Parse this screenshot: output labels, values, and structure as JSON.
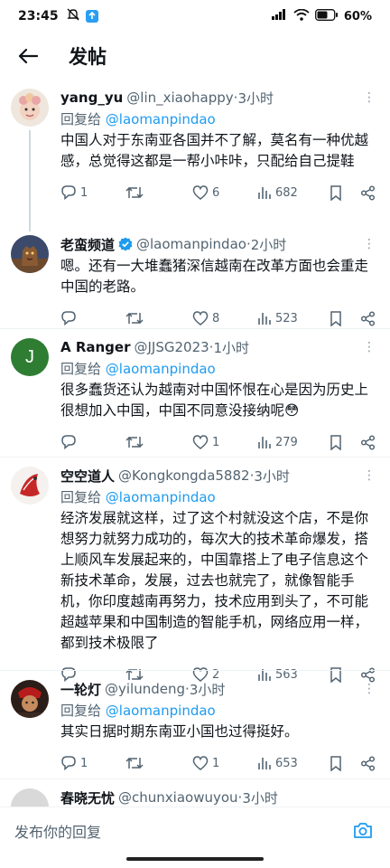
{
  "status_bar": {
    "time": "23:45",
    "battery": "60%"
  },
  "header": {
    "title": "发帖"
  },
  "tweets": [
    {
      "name": "yang_yu",
      "handle": "@lin_xiaohappy",
      "dot": "·",
      "time": "3小时",
      "reply_prefix": "回复给 ",
      "reply_mention": "@laomanpindao",
      "text": "中国人对于东南亚各国并不了解，莫名有一种优越感，总觉得这都是一帮小咔咔，只配给自己提鞋",
      "replies": "1",
      "retweets": "",
      "likes": "6",
      "views": "682"
    },
    {
      "name": "老蛮频道",
      "handle": "@laomanpindao",
      "dot": "·",
      "time": "2小时",
      "verified": true,
      "text": "嗯。还有一大堆蠢猪深信越南在改革方面也会重走中国的老路。",
      "replies": "",
      "retweets": "",
      "likes": "8",
      "views": "523"
    },
    {
      "name": "A Ranger",
      "handle": "@JJSG2023",
      "dot": "·",
      "time": "1小时",
      "reply_prefix": "回复给 ",
      "reply_mention": "@laomanpindao",
      "text": "很多蠢货还认为越南对中国怀恨在心是因为历史上很想加入中国，中国不同意没接纳呢😳",
      "replies": "",
      "retweets": "",
      "likes": "1",
      "views": "279"
    },
    {
      "name": "空空道人",
      "handle": "@Kongkongda5882",
      "dot": "·",
      "time": "3小时",
      "reply_prefix": "回复给 ",
      "reply_mention": "@laomanpindao",
      "text": "经济发展就这样，过了这个村就没这个店，不是你想努力就努力成功的，每次大的技术革命爆发，搭上顺风车发展起来的，中国靠搭上了电子信息这个新技术革命，发展，过去也就完了，就像智能手机，你印度越南再努力，技术应用到头了，不可能超越苹果和中国制造的智能手机，网络应用一样，都到技术极限了",
      "replies": "",
      "retweets": "",
      "likes": "2",
      "views": "563"
    },
    {
      "name": "一轮灯",
      "handle": "@yilundeng",
      "dot": "·",
      "time": "3小时",
      "reply_prefix": "回复给 ",
      "reply_mention": "@laomanpindao",
      "text": "其实日据时期东南亚小国也过得挺好。",
      "replies": "1",
      "retweets": "",
      "likes": "1",
      "views": "653"
    },
    {
      "name": "春晓无忧",
      "handle": "@chunxiaowuyou",
      "dot": "·",
      "time": "3小时"
    }
  ],
  "reply_bar": {
    "placeholder": "发布你的回复"
  },
  "colors": {
    "accent": "#1d9bf0",
    "secondary_text": "#536471",
    "divider": "#eff3f4"
  }
}
